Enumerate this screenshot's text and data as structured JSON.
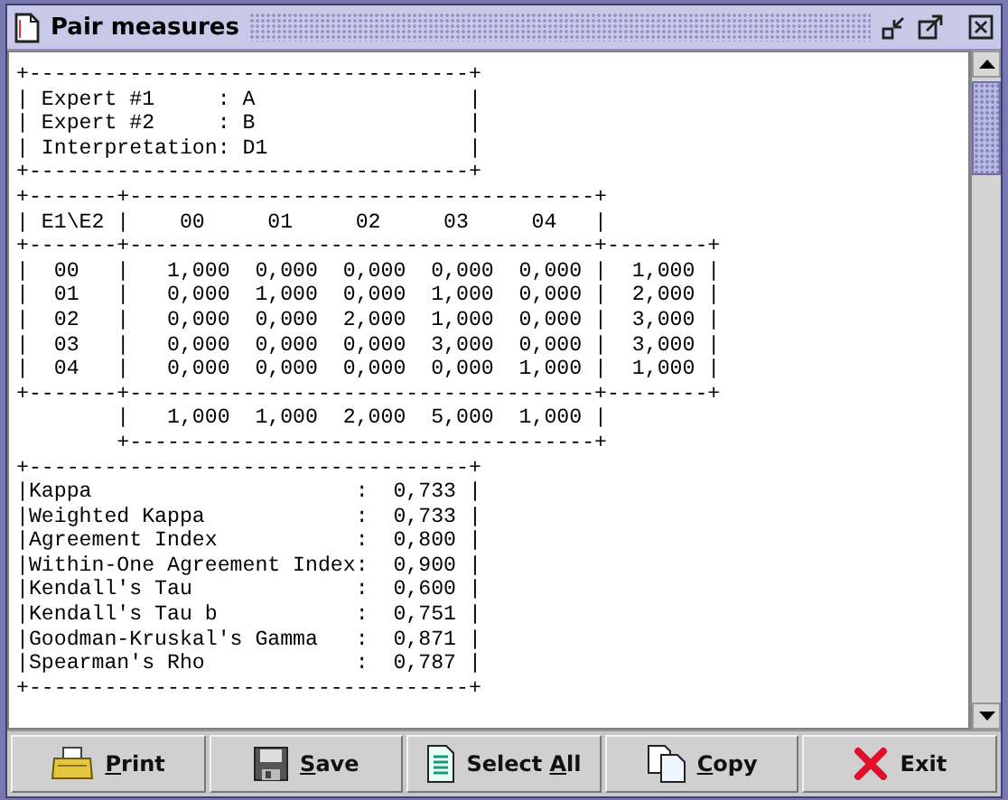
{
  "window": {
    "title": "Pair measures"
  },
  "report_lines": [
    "+-----------------------------------+",
    "| Expert #1     : A                 |",
    "| Expert #2     : B                 |",
    "| Interpretation: D1                |",
    "+-----------------------------------+",
    "+-------+-------------------------------------+",
    "| E1\\E2 |    00     01     02     03     04   |",
    "+-------+-------------------------------------+--------+",
    "|  00   |   1,000  0,000  0,000  0,000  0,000 |  1,000 |",
    "|  01   |   0,000  1,000  0,000  1,000  0,000 |  2,000 |",
    "|  02   |   0,000  0,000  2,000  1,000  0,000 |  3,000 |",
    "|  03   |   0,000  0,000  0,000  3,000  0,000 |  3,000 |",
    "|  04   |   0,000  0,000  0,000  0,000  1,000 |  1,000 |",
    "+-------+-------------------------------------+--------+",
    "        |   1,000  1,000  2,000  5,000  1,000 |",
    "        +-------------------------------------+",
    "+-----------------------------------+",
    "|Kappa                     :  0,733 |",
    "|Weighted Kappa            :  0,733 |",
    "|Agreement Index           :  0,800 |",
    "|Within-One Agreement Index:  0,900 |",
    "|Kendall's Tau             :  0,600 |",
    "|Kendall's Tau b           :  0,751 |",
    "|Goodman-Kruskal's Gamma   :  0,871 |",
    "|Spearman's Rho            :  0,787 |",
    "+-----------------------------------+"
  ],
  "buttons": [
    {
      "kind": "print",
      "key": "P",
      "after": "rint"
    },
    {
      "kind": "save",
      "key": "S",
      "after": "ave"
    },
    {
      "kind": "select-all",
      "before": "Select ",
      "key": "A",
      "after": "ll"
    },
    {
      "kind": "copy",
      "key": "C",
      "after": "opy"
    },
    {
      "kind": "exit",
      "before": "Exit"
    }
  ]
}
